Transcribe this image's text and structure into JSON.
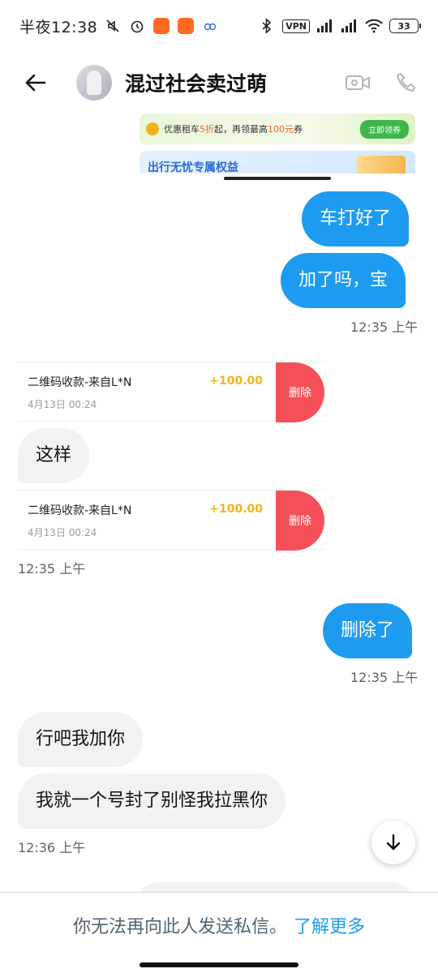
{
  "status_bar": {
    "time": "半夜12:38",
    "vpn": "VPN",
    "battery": "33",
    "icons": [
      "mute-icon",
      "alarm-icon",
      "app-icon",
      "video-icon",
      "link-icon",
      "bluetooth-icon",
      "signal-icon",
      "signal-icon",
      "wifi-icon"
    ]
  },
  "header": {
    "title": "混过社会卖过萌",
    "back_icon": "arrow-left-icon",
    "video_icon": "video-call-icon",
    "phone_icon": "phone-icon"
  },
  "ad": {
    "line1_prefix": "优惠租车",
    "line1_highlight": "5折",
    "line1_middle": "起，再领最高",
    "line1_highlight2": "100元",
    "line1_suffix": "券",
    "cta": "立即领券",
    "line2": "出行无忧专属权益"
  },
  "messages": {
    "m1": "车打好了",
    "m2": "加了吗，宝",
    "t1": "12:35 上午",
    "card1": {
      "title": "二维码收款-来自L*N",
      "amount": "+100.00",
      "date": "4月13日 00:24",
      "delete": "删除"
    },
    "m3": "这样",
    "card2": {
      "title": "二维码收款-来自L*N",
      "amount": "+100.00",
      "date": "4月13日 00:24",
      "delete": "删除"
    },
    "t2": "12:35 上午",
    "m4": "删除了",
    "t3": "12:35 上午",
    "m5": "行吧我加你",
    "m6": "我就一个号封了别怪我拉黑你",
    "t4": "12:36 上午"
  },
  "footer": {
    "notice": "你无法再向此人发送私信。",
    "link": "了解更多"
  },
  "colors": {
    "accent": "#1d9bf0",
    "bubble_in": "#eff3f4",
    "delete_red": "#f5505a",
    "amount_gold": "#f1b41a"
  }
}
